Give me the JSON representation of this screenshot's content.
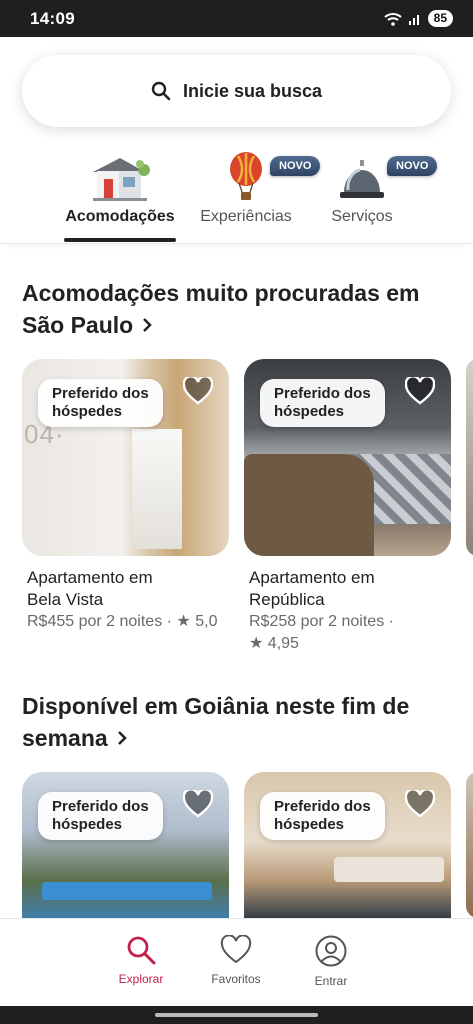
{
  "status": {
    "time": "14:09",
    "battery": "85"
  },
  "search": {
    "placeholder": "Inicie sua busca"
  },
  "categories": [
    {
      "label": "Acomodações",
      "active": true
    },
    {
      "label": "Experiências",
      "badge": "NOVO"
    },
    {
      "label": "Serviços",
      "badge": "NOVO"
    }
  ],
  "sections": [
    {
      "title_line1": "Acomodações muito procuradas em",
      "title_line2": "São Paulo",
      "cards": [
        {
          "badge": "Preferido dos hóspedes",
          "badge_l1": "Preferido dos",
          "badge_l2": "hóspedes",
          "title_l1": "Apartamento em",
          "title_l2": "Bela Vista",
          "price": "R$455 por 2 noites",
          "rating": "5,0"
        },
        {
          "badge": "Preferido dos hóspedes",
          "badge_l1": "Preferido dos",
          "badge_l2": "hóspedes",
          "title_l1": "Apartamento em",
          "title_l2": "República",
          "price": "R$258 por 2 noites",
          "rating": "4,95"
        }
      ]
    },
    {
      "title_line1": "Disponível em Goiânia neste fim de",
      "title_line2": "semana",
      "cards": [
        {
          "badge_l1": "Preferido dos",
          "badge_l2": "hóspedes"
        },
        {
          "badge_l1": "Preferido dos",
          "badge_l2": "hóspedes"
        }
      ]
    }
  ],
  "nav": [
    {
      "label": "Explorar",
      "icon": "search-icon",
      "active": true
    },
    {
      "label": "Favoritos",
      "icon": "heart-icon"
    },
    {
      "label": "Entrar",
      "icon": "profile-icon"
    }
  ],
  "colors": {
    "accent": "#c1224b",
    "badge": "#3b5478",
    "text": "#222222"
  }
}
